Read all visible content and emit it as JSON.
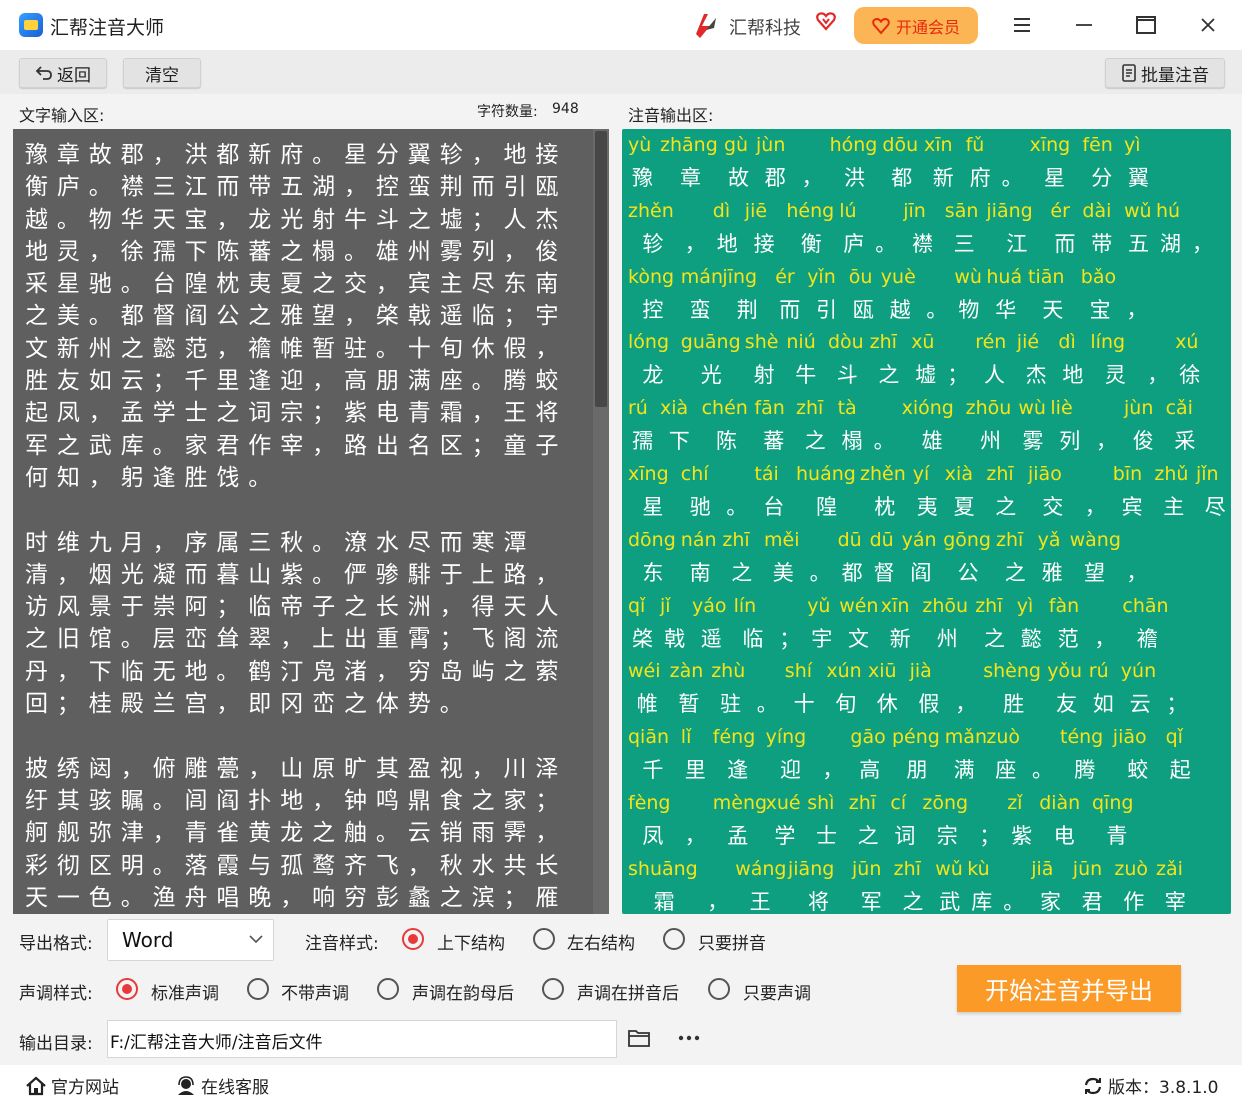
{
  "app": {
    "title": "汇帮注音大师",
    "brand": "汇帮科技",
    "vip_label": "开通会员"
  },
  "toolbar": {
    "back_label": "返回",
    "clear_label": "清空",
    "batch_label": "批量注音"
  },
  "input": {
    "label": "文字输入区:",
    "count_label": "字符数量:",
    "count": "948",
    "text": "豫章故郡，洪都新府。星分翼轸，地接衡庐。襟三江而带五湖，控蛮荆而引瓯越。物华天宝，龙光射牛斗之墟；人杰地灵，徐孺下陈蕃之榻。雄州雾列，俊采星驰。台隍枕夷夏之交，宾主尽东南之美。都督阎公之雅望，棨戟遥临；宇文新州之懿范，襜帷暂驻。十旬休假，胜友如云；千里逢迎，高朋满座。腾蛟起凤，孟学士之词宗；紫电青霜，王将军之武库。家君作宰，路出名区；童子何知，躬逢胜饯。\n\n时维九月，序属三秋。潦水尽而寒潭清，烟光凝而暮山紫。俨骖騑于上路，访风景于崇阿；临帝子之长洲，得天人之旧馆。层峦耸翠，上出重霄；飞阁流丹，下临无地。鹤汀凫渚，穷岛屿之萦回；桂殿兰宫，即冈峦之体势。\n\n披绣闼，俯雕甍，山原旷其盈视，川泽纡其骇瞩。闾阎扑地，钟鸣鼎食之家；舸舰弥津，青雀黄龙之舳。云销雨霁，彩彻区明。落霞与孤鹜齐飞，秋水共长天一色。渔舟唱晚，响穷彭蠡之滨；雁"
  },
  "output": {
    "label": "注音输出区:",
    "rows": [
      {
        "items": [
          [
            "yù",
            "豫"
          ],
          [
            "zhāng",
            "章"
          ],
          [
            "gù",
            "故"
          ],
          [
            "jùn",
            "郡"
          ],
          [
            "",
            "，"
          ],
          [
            "hóng",
            "洪"
          ],
          [
            "dōu",
            "都"
          ],
          [
            "xīn",
            "新"
          ],
          [
            "fǔ",
            "府"
          ],
          [
            "",
            "。"
          ],
          [
            "xīng",
            "星"
          ],
          [
            "fēn",
            "分"
          ],
          [
            "yì",
            "翼"
          ]
        ]
      },
      {
        "items": [
          [
            "zhěn",
            "轸"
          ],
          [
            "",
            "，"
          ],
          [
            "dì",
            "地"
          ],
          [
            "jiē",
            "接"
          ],
          [
            "héng",
            "衡"
          ],
          [
            "lú",
            "庐"
          ],
          [
            "",
            "。"
          ],
          [
            "jīn",
            "襟"
          ],
          [
            "sān",
            "三"
          ],
          [
            "jiāng",
            "江"
          ],
          [
            "ér",
            "而"
          ],
          [
            "dài",
            "带"
          ],
          [
            "wǔ",
            "五"
          ],
          [
            "hú",
            "湖"
          ],
          [
            "",
            "，"
          ]
        ]
      },
      {
        "items": [
          [
            "kòng",
            "控"
          ],
          [
            "mán",
            "蛮"
          ],
          [
            "jīng",
            "荆"
          ],
          [
            "ér",
            "而"
          ],
          [
            "yǐn",
            "引"
          ],
          [
            "ōu",
            "瓯"
          ],
          [
            "yuè",
            "越"
          ],
          [
            "",
            "。"
          ],
          [
            "wù",
            "物"
          ],
          [
            "huá",
            "华"
          ],
          [
            "tiān",
            "天"
          ],
          [
            "bǎo",
            "宝"
          ],
          [
            "",
            "，"
          ]
        ]
      },
      {
        "items": [
          [
            "lóng",
            "龙"
          ],
          [
            "guāng",
            "光"
          ],
          [
            "shè",
            "射"
          ],
          [
            "niú",
            "牛"
          ],
          [
            "dòu",
            "斗"
          ],
          [
            "zhī",
            "之"
          ],
          [
            "xū",
            "墟"
          ],
          [
            "",
            "；"
          ],
          [
            "rén",
            "人"
          ],
          [
            "jié",
            "杰"
          ],
          [
            "dì",
            "地"
          ],
          [
            "líng",
            "灵"
          ],
          [
            "",
            "，"
          ],
          [
            "xú",
            "徐"
          ]
        ]
      },
      {
        "items": [
          [
            "rú",
            "孺"
          ],
          [
            "xià",
            "下"
          ],
          [
            "chén",
            "陈"
          ],
          [
            "fān",
            "蕃"
          ],
          [
            "zhī",
            "之"
          ],
          [
            "tà",
            "榻"
          ],
          [
            "",
            "。"
          ],
          [
            "xióng",
            "雄"
          ],
          [
            "zhōu",
            "州"
          ],
          [
            "wù",
            "雾"
          ],
          [
            "liè",
            "列"
          ],
          [
            "",
            "，"
          ],
          [
            "jùn",
            "俊"
          ],
          [
            "cǎi",
            "采"
          ]
        ]
      },
      {
        "items": [
          [
            "xīng",
            "星"
          ],
          [
            "chí",
            "驰"
          ],
          [
            "",
            "。"
          ],
          [
            "tái",
            "台"
          ],
          [
            "huáng",
            "隍"
          ],
          [
            "zhěn",
            "枕"
          ],
          [
            "yí",
            "夷"
          ],
          [
            "xià",
            "夏"
          ],
          [
            "zhī",
            "之"
          ],
          [
            "jiāo",
            "交"
          ],
          [
            "",
            "，"
          ],
          [
            "bīn",
            "宾"
          ],
          [
            "zhǔ",
            "主"
          ],
          [
            "jǐn",
            "尽"
          ]
        ]
      },
      {
        "items": [
          [
            "dōng",
            "东"
          ],
          [
            "nán",
            "南"
          ],
          [
            "zhī",
            "之"
          ],
          [
            "měi",
            "美"
          ],
          [
            "",
            "。"
          ],
          [
            "dū",
            "都"
          ],
          [
            "dū",
            "督"
          ],
          [
            "yán",
            "阎"
          ],
          [
            "gōng",
            "公"
          ],
          [
            "zhī",
            "之"
          ],
          [
            "yǎ",
            "雅"
          ],
          [
            "wàng",
            "望"
          ],
          [
            "",
            "，"
          ]
        ]
      },
      {
        "items": [
          [
            "qǐ",
            "棨"
          ],
          [
            "jǐ",
            "戟"
          ],
          [
            "yáo",
            "遥"
          ],
          [
            "lín",
            "临"
          ],
          [
            "",
            "；"
          ],
          [
            "yǔ",
            "宇"
          ],
          [
            "wén",
            "文"
          ],
          [
            "xīn",
            "新"
          ],
          [
            "zhōu",
            "州"
          ],
          [
            "zhī",
            "之"
          ],
          [
            "yì",
            "懿"
          ],
          [
            "fàn",
            "范"
          ],
          [
            "",
            "，"
          ],
          [
            "chān",
            "襜"
          ]
        ]
      },
      {
        "items": [
          [
            "wéi",
            "帷"
          ],
          [
            "zàn",
            "暂"
          ],
          [
            "zhù",
            "驻"
          ],
          [
            "",
            "。"
          ],
          [
            "shí",
            "十"
          ],
          [
            "xún",
            "旬"
          ],
          [
            "xiū",
            "休"
          ],
          [
            "jià",
            "假"
          ],
          [
            "",
            "，"
          ],
          [
            "shèng",
            "胜"
          ],
          [
            "yǒu",
            "友"
          ],
          [
            "rú",
            "如"
          ],
          [
            "yún",
            "云"
          ],
          [
            "",
            "；"
          ]
        ]
      },
      {
        "items": [
          [
            "qiān",
            "千"
          ],
          [
            "lǐ",
            "里"
          ],
          [
            "féng",
            "逢"
          ],
          [
            "yíng",
            "迎"
          ],
          [
            "",
            "，"
          ],
          [
            "gāo",
            "高"
          ],
          [
            "péng",
            "朋"
          ],
          [
            "mǎn",
            "满"
          ],
          [
            "zuò",
            "座"
          ],
          [
            "",
            "。"
          ],
          [
            "téng",
            "腾"
          ],
          [
            "jiāo",
            "蛟"
          ],
          [
            "qǐ",
            "起"
          ]
        ]
      },
      {
        "items": [
          [
            "fèng",
            "凤"
          ],
          [
            "",
            "，"
          ],
          [
            "mèng",
            "孟"
          ],
          [
            "xué",
            "学"
          ],
          [
            "shì",
            "士"
          ],
          [
            "zhī",
            "之"
          ],
          [
            "cí",
            "词"
          ],
          [
            "zōng",
            "宗"
          ],
          [
            "",
            "；"
          ],
          [
            "zǐ",
            "紫"
          ],
          [
            "diàn",
            "电"
          ],
          [
            "qīng",
            "青"
          ]
        ]
      },
      {
        "items": [
          [
            "shuāng",
            "霜"
          ],
          [
            "",
            "，"
          ],
          [
            "wáng",
            "王"
          ],
          [
            "jiāng",
            "将"
          ],
          [
            "jūn",
            "军"
          ],
          [
            "zhī",
            "之"
          ],
          [
            "wǔ",
            "武"
          ],
          [
            "kù",
            "库"
          ],
          [
            "",
            "。"
          ],
          [
            "jiā",
            "家"
          ],
          [
            "jūn",
            "君"
          ],
          [
            "zuò",
            "作"
          ],
          [
            "zǎi",
            "宰"
          ]
        ]
      }
    ]
  },
  "options": {
    "export_label": "导出格式:",
    "export_value": "Word",
    "style_label": "注音样式:",
    "style_options": [
      "上下结构",
      "左右结构",
      "只要拼音"
    ],
    "tone_label": "声调样式:",
    "tone_options": [
      "标准声调",
      "不带声调",
      "声调在韵母后",
      "声调在拼音后",
      "只要声调"
    ],
    "dir_label": "输出目录:",
    "dir_value": "F:/汇帮注音大师/注音后文件",
    "start_label": "开始注音并导出"
  },
  "status": {
    "site_label": "官方网站",
    "service_label": "在线客服",
    "version_label": "版本：3.8.1.0"
  },
  "colors": {
    "accent": "#fb9a26",
    "output_bg": "#0e9f80",
    "pinyin": "#f5e418",
    "input_bg": "#5f5f5f",
    "radio_on": "#e83a3a"
  }
}
